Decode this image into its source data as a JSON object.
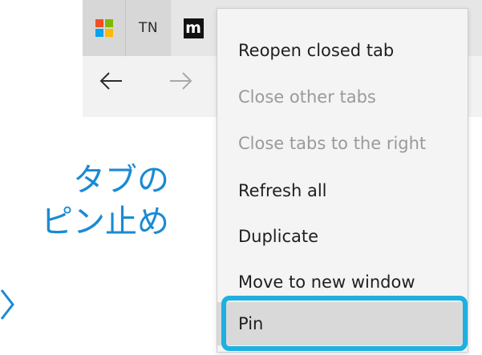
{
  "tabs": [
    {
      "id": "microsoft",
      "icon": "microsoft-logo-icon",
      "label": ""
    },
    {
      "id": "tn",
      "label": "TN"
    },
    {
      "id": "m",
      "label": "m"
    }
  ],
  "nav": {
    "back_icon": "arrow-left-icon",
    "forward_icon": "arrow-right-icon"
  },
  "context_menu": {
    "items": [
      {
        "label": "Reopen closed tab",
        "enabled": true
      },
      {
        "label": "Close other tabs",
        "enabled": false
      },
      {
        "label": "Close tabs to the right",
        "enabled": false
      },
      {
        "label": "Refresh all",
        "enabled": true
      },
      {
        "label": "Duplicate",
        "enabled": true
      },
      {
        "label": "Move to new window",
        "enabled": true
      },
      {
        "label": "Pin",
        "enabled": true,
        "highlighted": true
      }
    ]
  },
  "annotation": {
    "line1": "タブの",
    "line2": "ピン止め"
  },
  "colors": {
    "annotation_text": "#1a8ad4",
    "highlight_border": "#1eb0e0",
    "menu_bg": "#f4f4f4",
    "disabled_text": "#9a9a9a"
  }
}
